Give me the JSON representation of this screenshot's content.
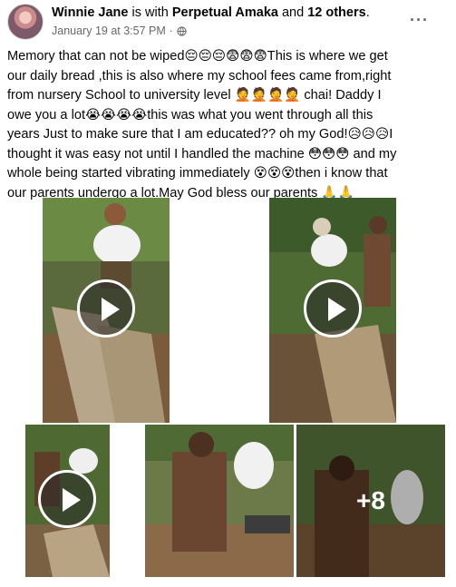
{
  "post": {
    "author": "Winnie Jane",
    "with_text": " is with ",
    "tagged": "Perpetual Amaka",
    "and_text": " and ",
    "others": "12 others",
    "end_text": ".",
    "timestamp": "January 19 at 3:57 PM",
    "separator": "·",
    "privacy_icon": "globe-icon",
    "more_icon": "more-options-icon",
    "text": "Memory that can not be wiped😔😔😔😨😨😨This is where we get our daily bread ,this is also where my school fees came from,right from nursery School to university level 🤦🤦🤦🤦 chai! Daddy I owe you a lot😭😭😭😭this was what you went through all this years Just to make sure that I am educated?? oh my God!😥😥😥I thought it was easy not until I handled the machine 😳😳😳 and my whole being started vibrating immediately 😵😵😵then i know that our parents undergo a lot.May God bless our parents 🙏🙏"
  },
  "media": {
    "more_count_label": "+8",
    "play_icon": "play-icon",
    "colors": {
      "accent_text": "#65676b",
      "overlay": "#ffffff"
    }
  }
}
